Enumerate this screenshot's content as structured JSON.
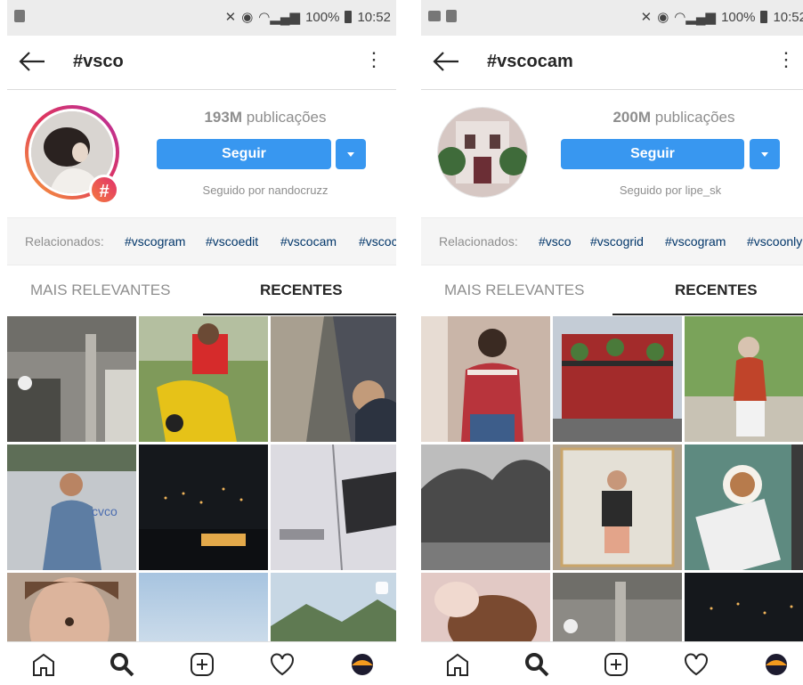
{
  "screens": [
    {
      "status": {
        "battery": "100%",
        "time": "10:52"
      },
      "title": "#vsco",
      "posts_count": "193M",
      "posts_label": "publicações",
      "follow_label": "Seguir",
      "followed_by": "Seguido por nandocruzz",
      "related_label": "Relacionados:",
      "related_tags": [
        "#vscogram",
        "#vscoedit",
        "#vscocam",
        "#vscoc"
      ],
      "tabs": [
        "MAIS RELEVANTES",
        "RECENTES"
      ],
      "active_tab": "RECENTES"
    },
    {
      "status": {
        "battery": "100%",
        "time": "10:52"
      },
      "title": "#vscocam",
      "posts_count": "200M",
      "posts_label": "publicações",
      "follow_label": "Seguir",
      "followed_by": "Seguido por lipe_sk",
      "related_label": "Relacionados:",
      "related_tags": [
        "#vsco",
        "#vscogrid",
        "#vscogram",
        "#vscoonly"
      ],
      "tabs": [
        "MAIS RELEVANTES",
        "RECENTES"
      ],
      "active_tab": "RECENTES"
    }
  ],
  "bottom_nav_icons": [
    "home-icon",
    "search-icon",
    "add-post-icon",
    "activity-heart-icon",
    "profile-avatar-icon"
  ],
  "colors": {
    "accent": "#3897f0",
    "tag_link": "#003569",
    "muted": "#8e8e8e",
    "badge": "#e1306c"
  }
}
